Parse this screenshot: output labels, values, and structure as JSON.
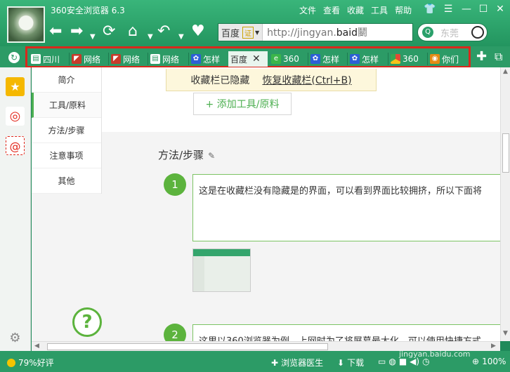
{
  "window": {
    "title": "360安全浏览器 6.3",
    "menu": [
      "文件",
      "查看",
      "收藏",
      "工具",
      "帮助"
    ]
  },
  "address_bar": {
    "site_label": "百度",
    "cert_label": "证",
    "url_prefix": "http://jingyan.",
    "url_domain": "baid",
    "url_tail": "鬭"
  },
  "search": {
    "placeholder": "东莞"
  },
  "tabs": [
    {
      "label": "四川",
      "icon": "document-icon"
    },
    {
      "label": "网络",
      "icon": "red-page-icon"
    },
    {
      "label": "网络",
      "icon": "red-page-icon"
    },
    {
      "label": "网络",
      "icon": "document-icon"
    },
    {
      "label": "怎样",
      "icon": "baidu-paw-icon"
    },
    {
      "label": "百度",
      "icon": "none",
      "active": true
    },
    {
      "label": "360",
      "icon": "360-green-icon"
    },
    {
      "label": "怎样",
      "icon": "baidu-paw-icon"
    },
    {
      "label": "怎样",
      "icon": "baidu-paw-icon"
    },
    {
      "label": "360",
      "icon": "chrome-icon"
    },
    {
      "label": "你们",
      "icon": "firefox-icon"
    }
  ],
  "page": {
    "nav": [
      "简介",
      "工具/原料",
      "方法/步骤",
      "注意事项",
      "其他"
    ],
    "nav_active": 1,
    "notice_text": "收藏栏已隐藏",
    "notice_link": "恢复收藏栏(Ctrl+B)",
    "add_tool_label": "+ 添加工具/原料",
    "section_title": "方法/步骤",
    "steps": [
      {
        "num": "1",
        "text": "这是在收藏栏没有隐藏是的界面，可以看到界面比较拥挤，所以下面将"
      },
      {
        "num": "2",
        "text": "这里以360浏览器为例，上网时为了将屏幕最大化，可以使用快捷方式"
      }
    ],
    "help_label": "?"
  },
  "status": {
    "rating": "79%好评",
    "doctor": "浏览器医生",
    "download": "下载",
    "zoom": "100%",
    "watermark": "jingyan.baidu.com"
  }
}
